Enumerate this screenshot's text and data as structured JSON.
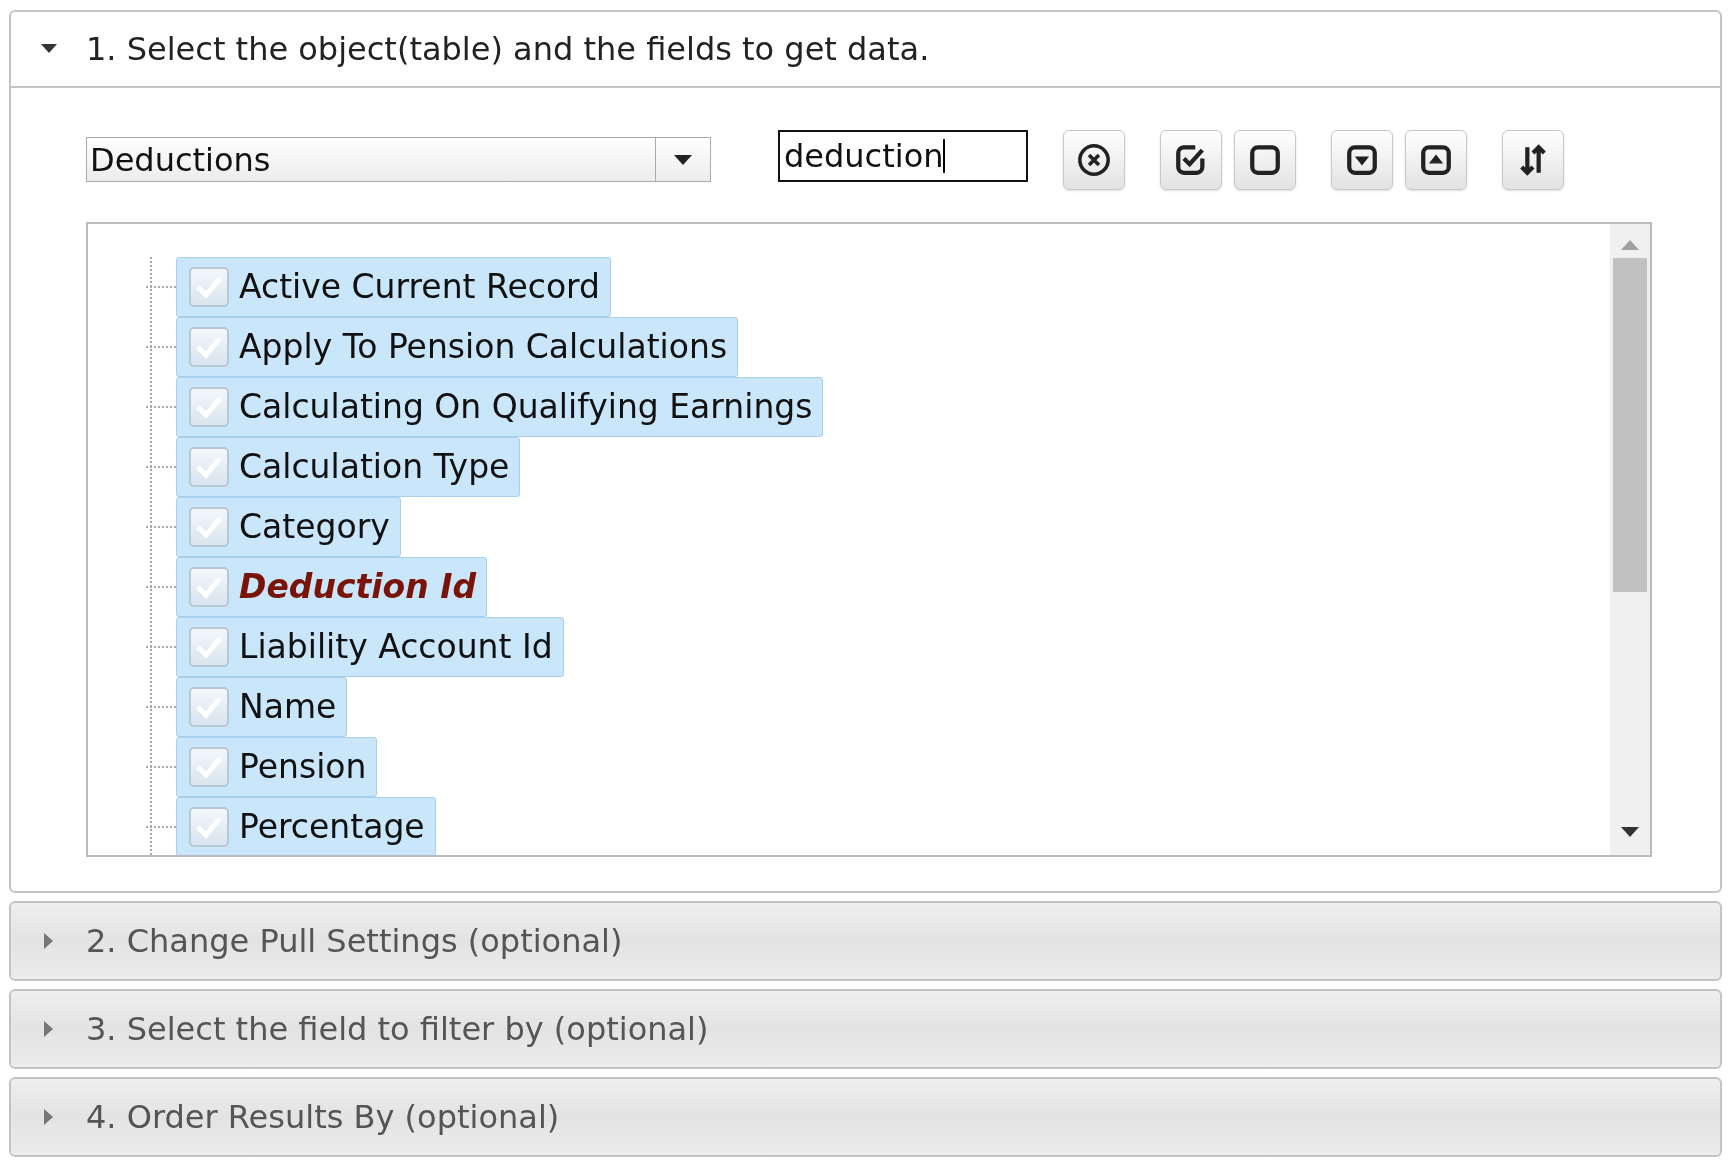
{
  "sections": [
    {
      "title": "1. Select the object(table) and the fields to get data.",
      "expanded": true
    },
    {
      "title": "2. Change Pull Settings (optional)",
      "expanded": false
    },
    {
      "title": "3. Select the field to filter by (optional)",
      "expanded": false
    },
    {
      "title": "4. Order Results By (optional)",
      "expanded": false
    }
  ],
  "object_select": {
    "value": "Deductions"
  },
  "search": {
    "value": "deduction"
  },
  "fields": [
    {
      "label": "Active Current Record",
      "checked": true,
      "selected": true,
      "key": false
    },
    {
      "label": "Apply To Pension Calculations",
      "checked": true,
      "selected": true,
      "key": false
    },
    {
      "label": "Calculating On Qualifying Earnings",
      "checked": true,
      "selected": true,
      "key": false
    },
    {
      "label": "Calculation Type",
      "checked": true,
      "selected": true,
      "key": false
    },
    {
      "label": "Category",
      "checked": true,
      "selected": true,
      "key": false
    },
    {
      "label": "Deduction Id",
      "checked": true,
      "selected": true,
      "key": true
    },
    {
      "label": "Liability Account Id",
      "checked": true,
      "selected": true,
      "key": false
    },
    {
      "label": "Name",
      "checked": true,
      "selected": true,
      "key": false
    },
    {
      "label": "Pension",
      "checked": true,
      "selected": true,
      "key": false
    },
    {
      "label": "Percentage",
      "checked": true,
      "selected": true,
      "key": false
    }
  ]
}
